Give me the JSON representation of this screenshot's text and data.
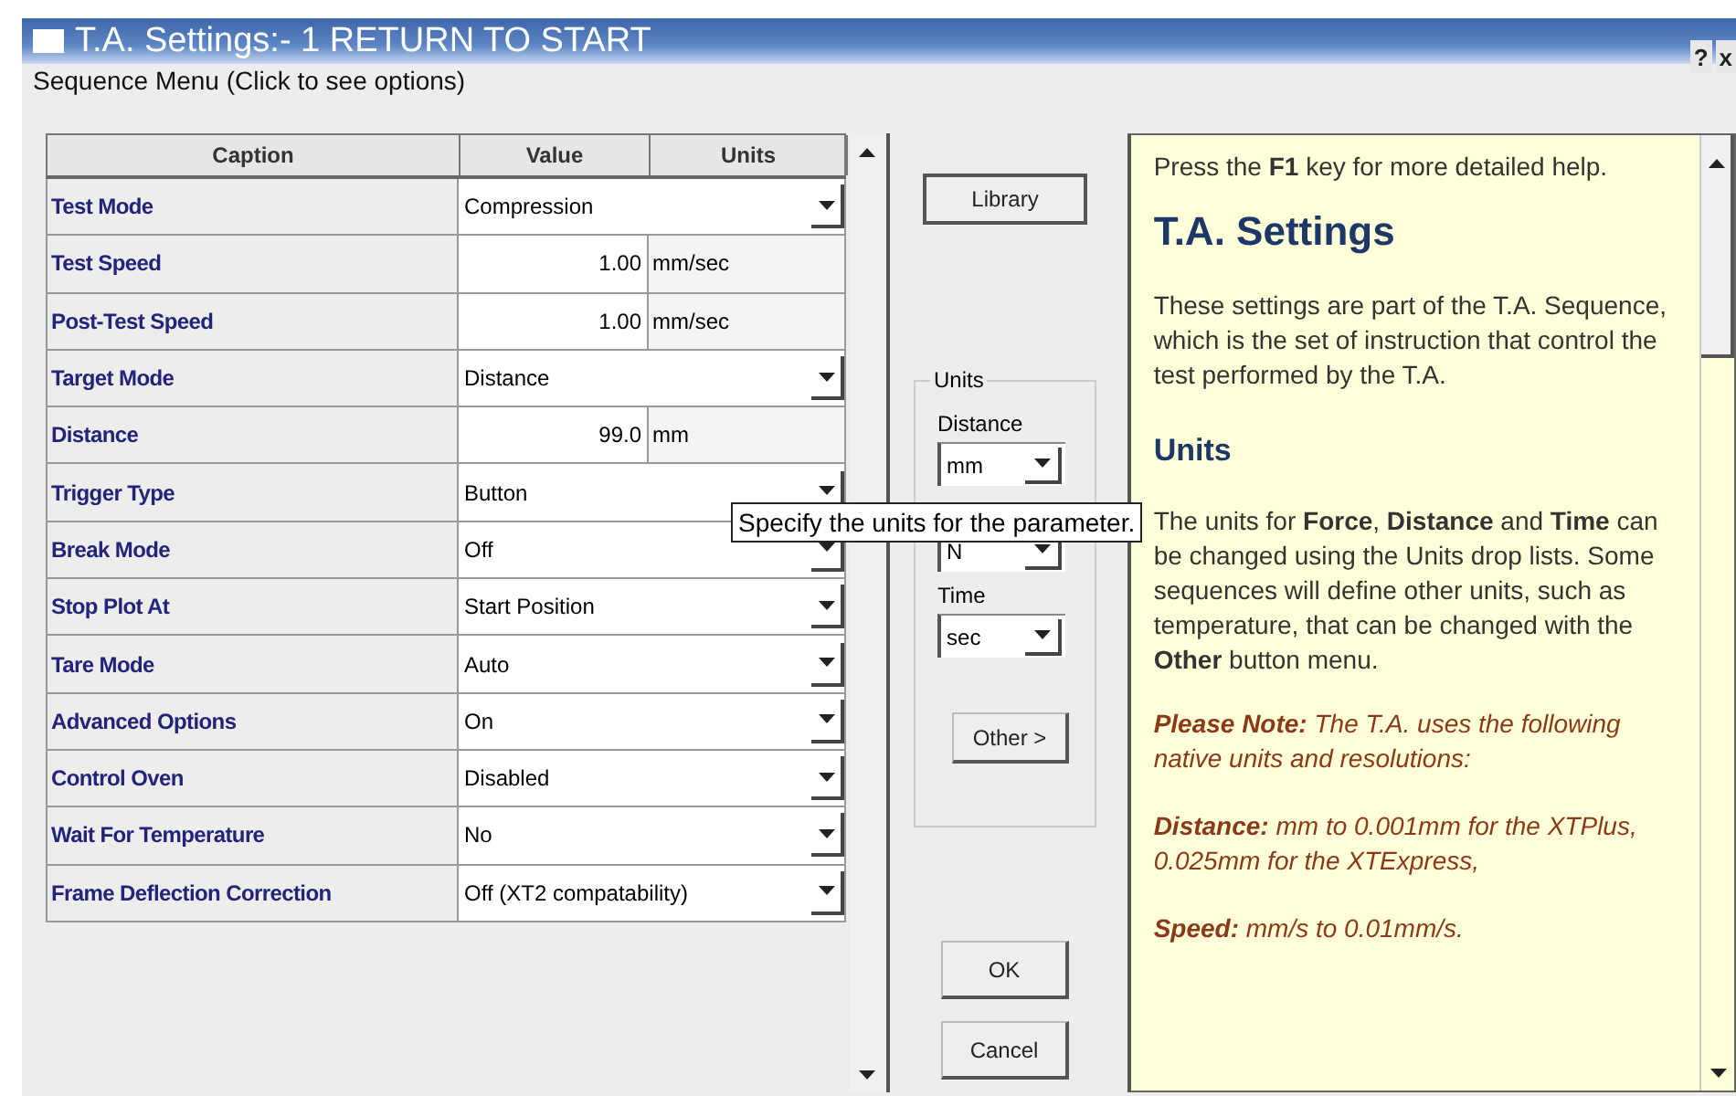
{
  "window": {
    "title": "T.A. Settings:- 1 RETURN TO START",
    "buttons": [
      "?",
      "x"
    ]
  },
  "sequence_menu": "Sequence Menu (Click to see options)",
  "table": {
    "columns": [
      "Caption",
      "Value",
      "Units"
    ],
    "rows": [
      {
        "caption": "Test Mode",
        "kind": "dropdown",
        "value": "Compression"
      },
      {
        "caption": "Test Speed",
        "kind": "number",
        "value": "1.00",
        "units": "mm/sec"
      },
      {
        "caption": "Post-Test Speed",
        "kind": "number",
        "value": "1.00",
        "units": "mm/sec"
      },
      {
        "caption": "Target Mode",
        "kind": "dropdown",
        "value": "Distance"
      },
      {
        "caption": "Distance",
        "kind": "number",
        "value": "99.0",
        "units": "mm"
      },
      {
        "caption": "Trigger Type",
        "kind": "dropdown",
        "value": "Button"
      },
      {
        "caption": "Break Mode",
        "kind": "dropdown",
        "value": "Off"
      },
      {
        "caption": "Stop Plot At",
        "kind": "dropdown",
        "value": "Start Position"
      },
      {
        "caption": "Tare Mode",
        "kind": "dropdown",
        "value": "Auto"
      },
      {
        "caption": "Advanced Options",
        "kind": "dropdown",
        "value": "On"
      },
      {
        "caption": "Control Oven",
        "kind": "dropdown",
        "value": "Disabled"
      },
      {
        "caption": "Wait For Temperature",
        "kind": "dropdown",
        "value": "No"
      },
      {
        "caption": "Frame Deflection Correction",
        "kind": "dropdown",
        "value": "Off (XT2 compatability)"
      }
    ]
  },
  "library_button": "Library",
  "units": {
    "legend": "Units",
    "items": [
      {
        "label": "Distance",
        "value": "mm"
      },
      {
        "value": "N"
      },
      {
        "label": "Time",
        "value": "sec"
      }
    ],
    "other_button": "Other >"
  },
  "ok_button": "OK",
  "cancel_button": "Cancel",
  "tooltip": "Specify the units for the parameter.",
  "help": [
    {
      "kind": "text",
      "text": "Press the **F1** key for more detailed help."
    },
    {
      "kind": "title",
      "text": "T.A. Settings"
    },
    {
      "kind": "text",
      "text": "These settings are part of the T.A. Sequence, which is the set of instruction that control the test performed by the T.A."
    },
    {
      "kind": "heading",
      "text": "Units"
    },
    {
      "kind": "text",
      "text": "The units for **Force**, **Distance** and **Time** can be changed using the Units drop lists. Some sequences will define other units, such as temperature, that can be changed with the **Other** button menu."
    },
    {
      "kind": "note",
      "text": "**Please Note:** The T.A. uses the following native units and resolutions:"
    },
    {
      "kind": "note",
      "text": "**Distance:** mm to 0.001mm for the XTPlus, 0.025mm for the XTExpress,"
    },
    {
      "kind": "note",
      "text": "**Speed:** mm/s to 0.01mm/s."
    }
  ]
}
